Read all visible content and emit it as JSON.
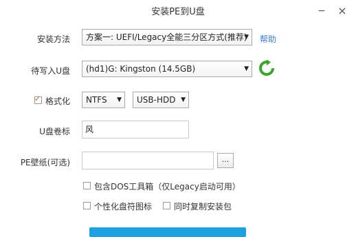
{
  "window": {
    "title": "安装PE到U盘",
    "minimize_glyph": "−",
    "close_glyph": "×"
  },
  "install_method": {
    "label": "安装方法",
    "value": "方案一: UEFI/Legacy全能三分区方式(推荐)",
    "help_link": "帮助"
  },
  "target_disk": {
    "label": "待写入U盘",
    "value": "(hd1)G: Kingston  (14.5GB)",
    "refresh_icon": "refresh-icon"
  },
  "format": {
    "label": "格式化",
    "checked": true,
    "filesystem": "NTFS",
    "mode": "USB-HDD"
  },
  "volume_label": {
    "label": "U盘卷标",
    "value": "风"
  },
  "wallpaper": {
    "label": "PE壁纸(可选)",
    "value": "",
    "browse_label": "..."
  },
  "options": {
    "include_dos": "包含DOS工具箱（仅Legacy启动可用）",
    "personalize_icon": "个性化盘符图标",
    "copy_installer": "同时复制安装包"
  },
  "colors": {
    "link": "#3b7dd8",
    "check": "#d9541e",
    "install_button": "#1ea1e0",
    "refresh": "#3aa52b"
  }
}
